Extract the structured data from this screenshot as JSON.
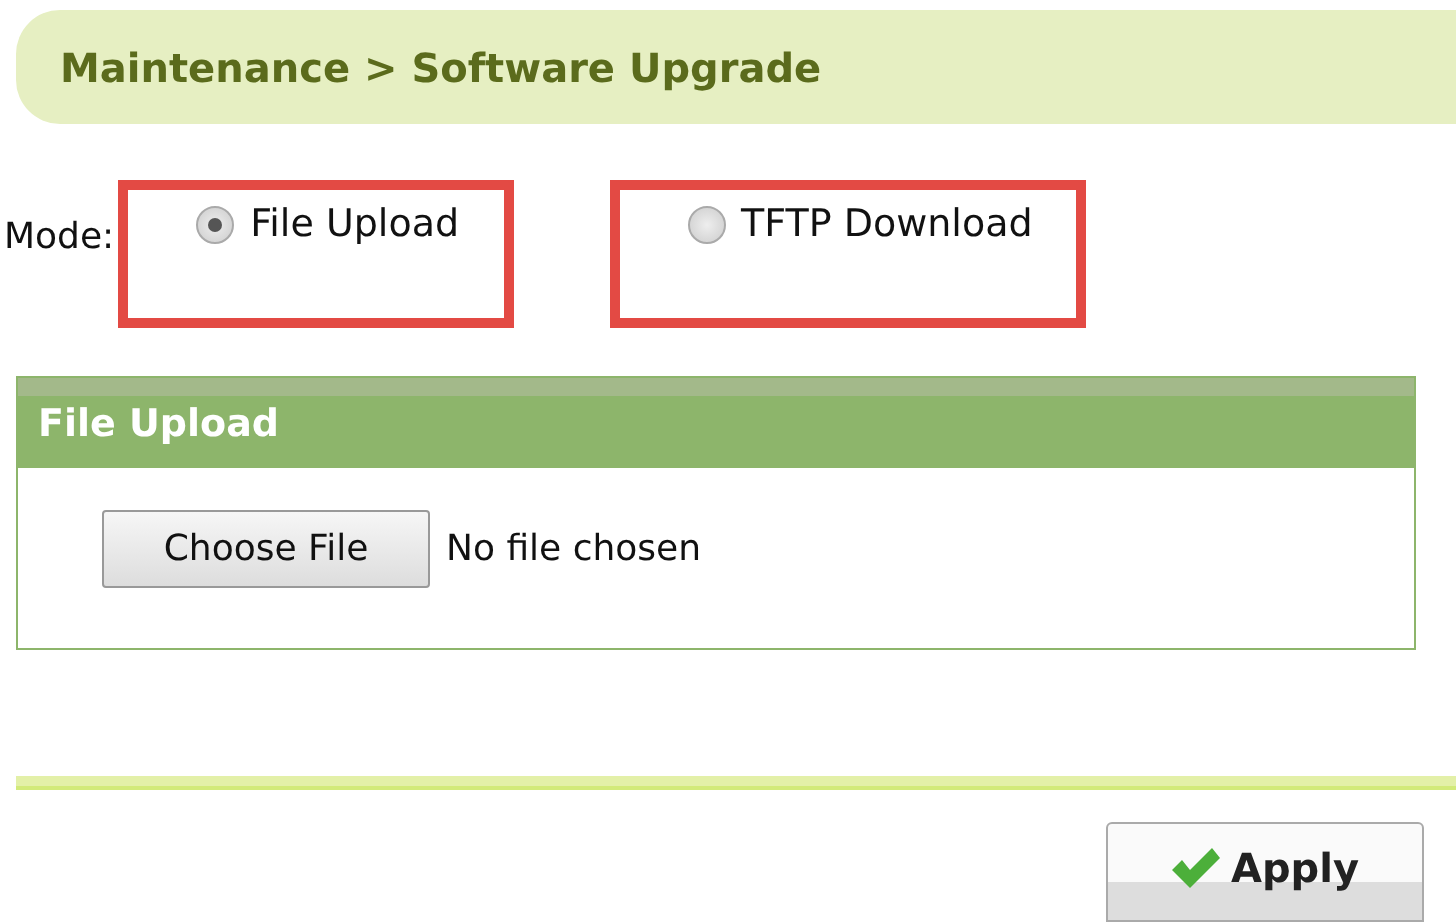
{
  "breadcrumb": "Maintenance > Software Upgrade",
  "mode": {
    "label": "Mode:",
    "options": [
      {
        "label": "File Upload",
        "selected": true,
        "highlighted": true
      },
      {
        "label": "TFTP Download",
        "selected": false,
        "highlighted": true
      }
    ]
  },
  "panel": {
    "title": "File Upload",
    "button": "Choose File",
    "status": "No file chosen"
  },
  "apply": "Apply"
}
